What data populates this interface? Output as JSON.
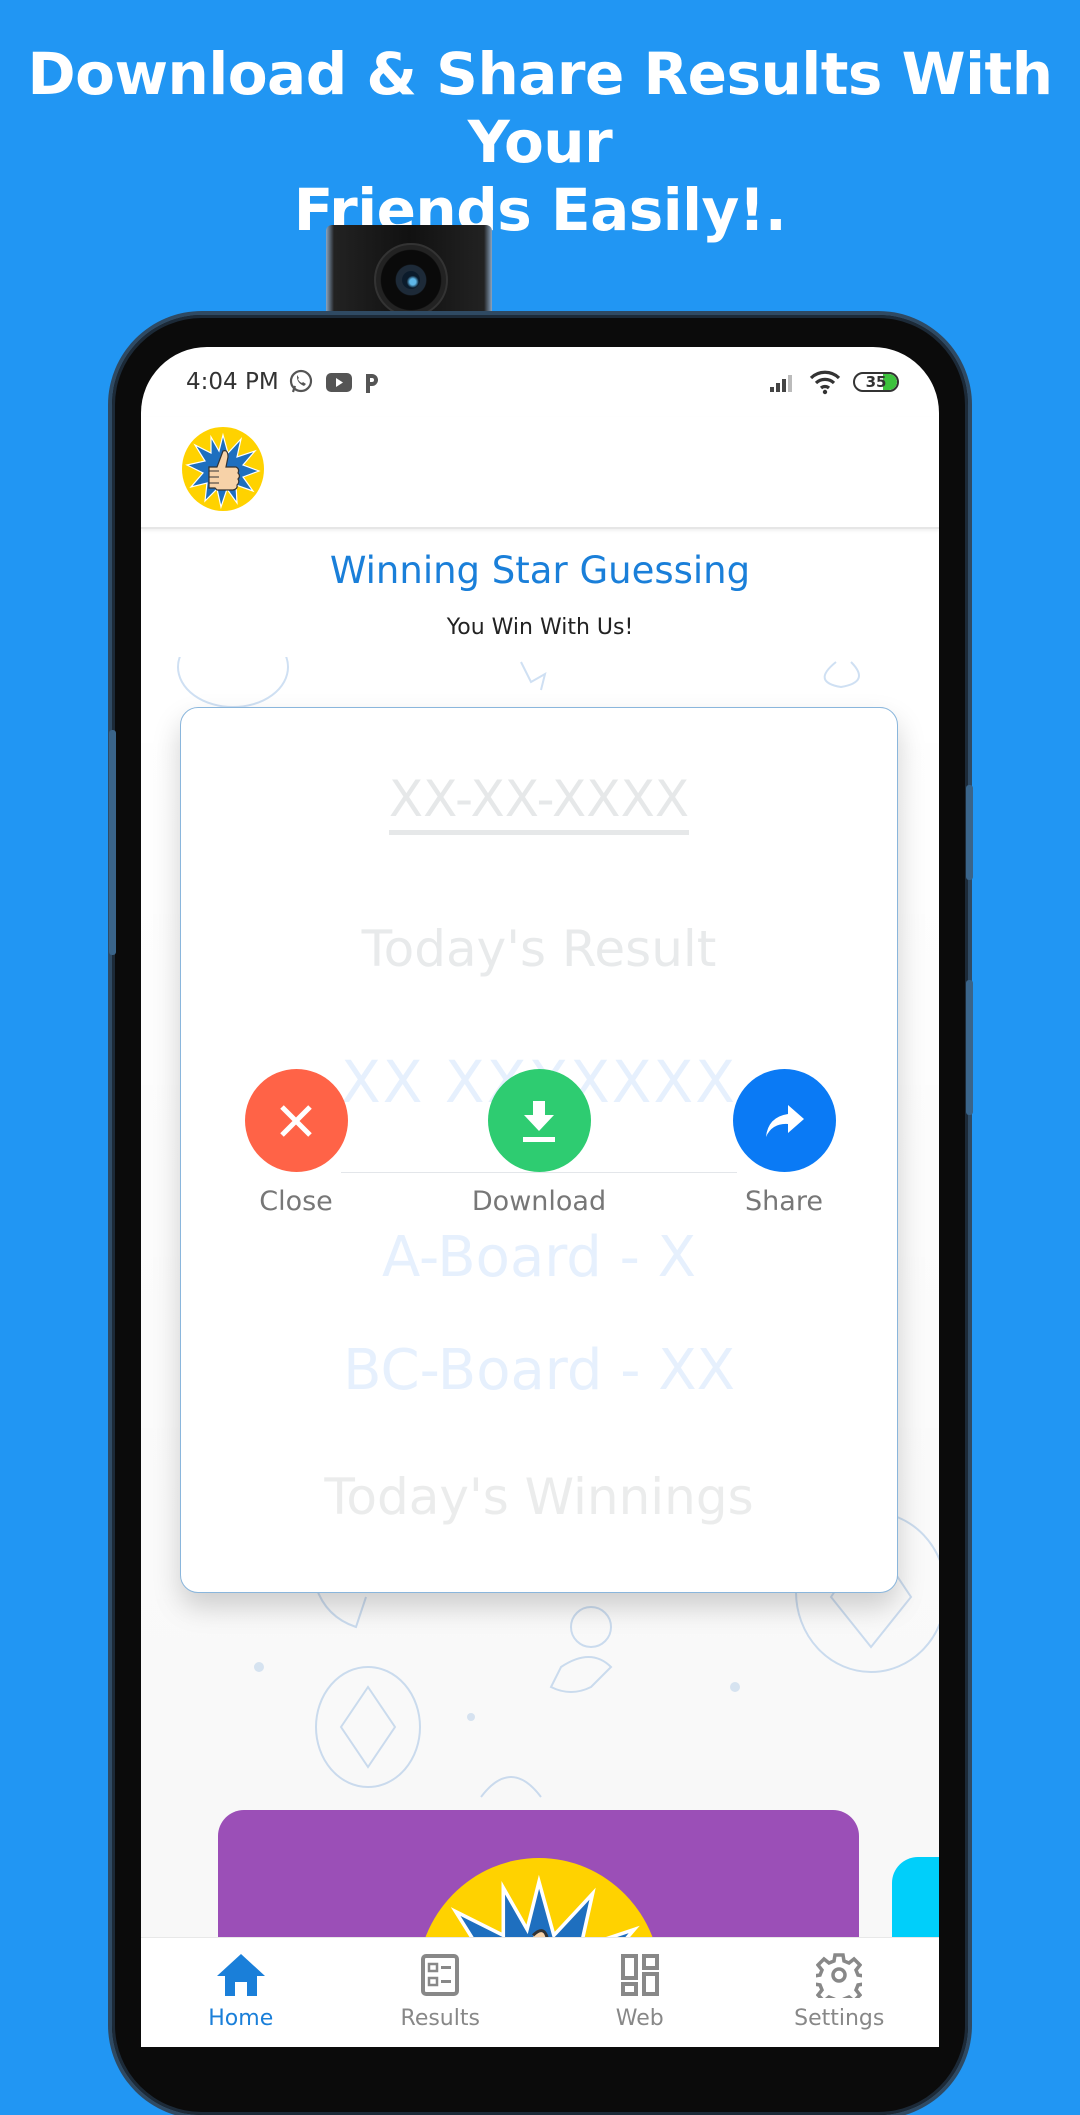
{
  "promo": {
    "headline_line1": "Download & Share Results With Your",
    "headline_line2": "Friends Easily!."
  },
  "status_bar": {
    "time": "4:04 PM",
    "notification_icons": [
      "whatsapp-icon",
      "youtube-icon",
      "paytm-icon"
    ],
    "signal_icon": "signal-icon",
    "wifi_icon": "wifi-icon",
    "battery_level": "35"
  },
  "app": {
    "logo": "thumbs-up-star-logo",
    "title": "Winning Star Guessing",
    "subtitle": "You Win With Us!"
  },
  "result_card": {
    "date": "XX-XX-XXXX",
    "heading": "Today's Result",
    "number": "XX XXXXXXX",
    "board_a": "A-Board - X",
    "board_bc": "BC-Board - XX",
    "winnings": "Today's Winnings"
  },
  "actions": [
    {
      "label": "Close",
      "icon": "close-icon",
      "color": "#FF6347"
    },
    {
      "label": "Download",
      "icon": "download-icon",
      "color": "#2ECC71"
    },
    {
      "label": "Share",
      "icon": "share-icon",
      "color": "#0A7AF5"
    }
  ],
  "bottom_nav": {
    "items": [
      {
        "label": "Home",
        "icon": "home-icon",
        "active": true
      },
      {
        "label": "Results",
        "icon": "results-icon",
        "active": false
      },
      {
        "label": "Web",
        "icon": "dashboard-icon",
        "active": false
      },
      {
        "label": "Settings",
        "icon": "gear-icon",
        "active": false
      }
    ],
    "active_color": "#1A7FD9",
    "inactive_color": "#888888"
  },
  "colors": {
    "background": "#2196F3",
    "banner": "#9B4FB7",
    "banner_next": "#00CFFA"
  }
}
